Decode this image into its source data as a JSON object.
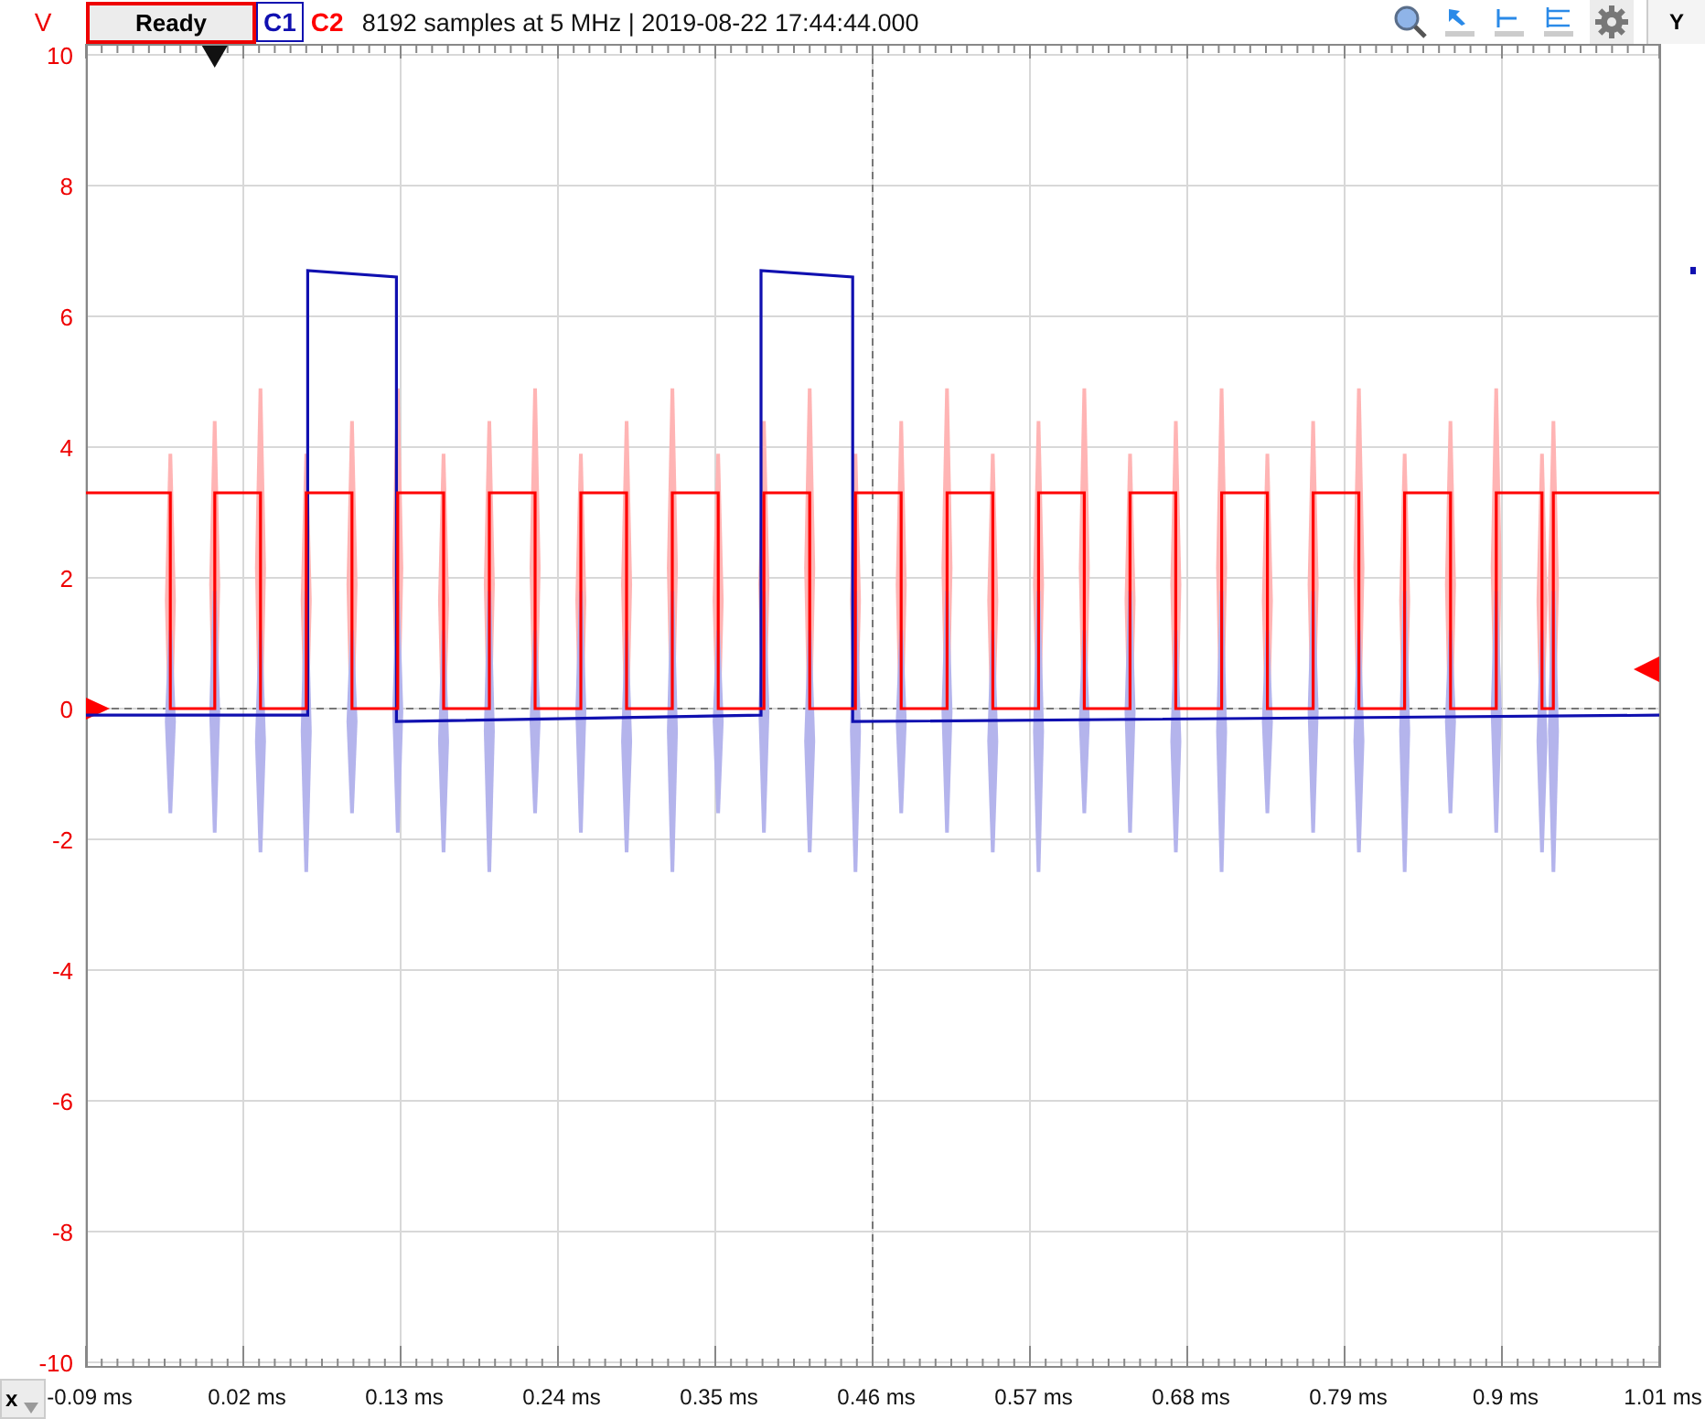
{
  "toolbar": {
    "y_unit": "V",
    "status": "Ready",
    "channels": [
      {
        "color": "#1010b0",
        "selected": true
      },
      {
        "color": "#ff0000",
        "selected": false
      }
    ],
    "info": "8192 samples at 5 MHz | 2019-08-22 17:44:44.000",
    "y_button": "Y"
  },
  "x_button": "x",
  "chart_data": {
    "type": "line",
    "grid": true,
    "xlim": [
      -0.09,
      1.01
    ],
    "ylim": [
      -10,
      10
    ],
    "xticks": [
      {
        "value": -0.09,
        "label": "-0.09 ms"
      },
      {
        "value": 0.02,
        "label": "0.02 ms"
      },
      {
        "value": 0.13,
        "label": "0.13 ms"
      },
      {
        "value": 0.24,
        "label": "0.24 ms"
      },
      {
        "value": 0.35,
        "label": "0.35 ms"
      },
      {
        "value": 0.46,
        "label": "0.46 ms"
      },
      {
        "value": 0.57,
        "label": "0.57 ms"
      },
      {
        "value": 0.68,
        "label": "0.68 ms"
      },
      {
        "value": 0.79,
        "label": "0.79 ms"
      },
      {
        "value": 0.9,
        "label": "0.9 ms"
      },
      {
        "value": 1.01,
        "label": "1.01 ms"
      }
    ],
    "yticks": [
      10,
      8,
      6,
      4,
      2,
      0,
      -2,
      -4,
      -6,
      -8,
      -10
    ],
    "series": [
      {
        "name": "C1",
        "color": "#1010b0",
        "x": [
          -0.09,
          0.065,
          0.065,
          0.127,
          0.127,
          0.382,
          0.382,
          0.446,
          0.446,
          1.01
        ],
        "values": [
          -0.1,
          -0.1,
          6.7,
          6.6,
          -0.2,
          -0.1,
          6.7,
          6.6,
          -0.2,
          -0.1
        ]
      },
      {
        "name": "C2",
        "color": "#ff0000",
        "x": [
          -0.09,
          -0.031,
          -0.031,
          0,
          0,
          0.032,
          0.032,
          0.064,
          0.064,
          0.096,
          0.096,
          0.128,
          0.128,
          0.16,
          0.16,
          0.192,
          0.192,
          0.224,
          0.224,
          0.256,
          0.256,
          0.288,
          0.288,
          0.32,
          0.32,
          0.352,
          0.352,
          0.384,
          0.384,
          0.416,
          0.416,
          0.448,
          0.448,
          0.48,
          0.48,
          0.512,
          0.512,
          0.544,
          0.544,
          0.576,
          0.576,
          0.608,
          0.608,
          0.64,
          0.64,
          0.672,
          0.672,
          0.704,
          0.704,
          0.736,
          0.736,
          0.768,
          0.768,
          0.8,
          0.8,
          0.832,
          0.832,
          0.864,
          0.864,
          0.896,
          0.896,
          0.928,
          0.928,
          0.936,
          0.936,
          1.01
        ],
        "values": [
          3.3,
          3.3,
          0,
          0,
          3.3,
          3.3,
          0,
          0,
          3.3,
          3.3,
          0,
          0,
          3.3,
          3.3,
          0,
          0,
          3.3,
          3.3,
          0,
          0,
          3.3,
          3.3,
          0,
          0,
          3.3,
          3.3,
          0,
          0,
          3.3,
          3.3,
          0,
          0,
          3.3,
          3.3,
          0,
          0,
          3.3,
          3.3,
          0,
          0,
          3.3,
          3.3,
          0,
          0,
          3.3,
          3.3,
          0,
          0,
          3.3,
          3.3,
          0,
          0,
          3.3,
          3.3,
          0,
          0,
          3.3,
          3.3,
          0,
          0,
          3.3,
          3.3,
          0,
          0,
          3.3,
          3.3
        ]
      }
    ]
  }
}
